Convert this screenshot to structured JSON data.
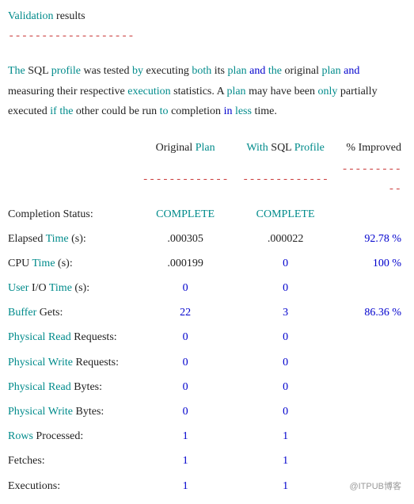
{
  "header": {
    "validation": "Validation",
    "results": "results",
    "divider": "-------------------"
  },
  "intro": {
    "w1": "The",
    "w2": "SQL",
    "w3": "profile",
    "w4": "was tested",
    "w5": "by",
    "w6": "executing",
    "w7": "both",
    "w8": "its",
    "w9": "plan",
    "w10": "and",
    "w11": "the",
    "w12": "original",
    "w13": "plan",
    "w14": "and",
    "w15": "measuring",
    "w16": "their respective",
    "w17": "execution",
    "w18": "statistics. A",
    "w19": "plan",
    "w20": "may have been",
    "w21": "only",
    "w22": "partially executed",
    "w23": "if",
    "w24": "the",
    "w25": "other could be run",
    "w26": "to",
    "w27": "completion",
    "w28": "in",
    "w29": "less",
    "w30": "time."
  },
  "cols": {
    "orig1": "Original",
    "orig2": "Plan",
    "prof1": "With",
    "prof2": "SQL",
    "prof3": "Profile",
    "imp": "% Improved",
    "dash_mid": "-------------",
    "dash_sm": "-----------"
  },
  "rows": {
    "completion": {
      "l1": "Completion",
      "l2": "Status:",
      "orig": "COMPLETE",
      "prof": "COMPLETE",
      "imp": ""
    },
    "elapsed": {
      "l1": "Elapsed",
      "l2": "Time",
      "l3": "(s):",
      "orig": ".000305",
      "prof": ".000022",
      "imp": "92.78 %"
    },
    "cpu": {
      "l1": "CPU",
      "l2": "Time",
      "l3": "(s):",
      "orig": ".000199",
      "prof": "0",
      "imp": "100 %"
    },
    "userio": {
      "l1": "User",
      "l2": "I/O",
      "l3": "Time",
      "l4": "(s):",
      "orig": "0",
      "prof": "0",
      "imp": ""
    },
    "buffer": {
      "l1": "Buffer",
      "l2": "Gets:",
      "orig": "22",
      "prof": "3",
      "imp": "86.36 %"
    },
    "preadreq": {
      "l1": "Physical",
      "l2": "Read",
      "l3": "Requests:",
      "orig": "0",
      "prof": "0",
      "imp": ""
    },
    "pwritereq": {
      "l1": "Physical",
      "l2": "Write",
      "l3": "Requests:",
      "orig": "0",
      "prof": "0",
      "imp": ""
    },
    "preadbyte": {
      "l1": "Physical",
      "l2": "Read",
      "l3": "Bytes:",
      "orig": "0",
      "prof": "0",
      "imp": ""
    },
    "pwritebyte": {
      "l1": "Physical",
      "l2": "Write",
      "l3": "Bytes:",
      "orig": "0",
      "prof": "0",
      "imp": ""
    },
    "rowsproc": {
      "l1": "Rows",
      "l2": "Processed:",
      "orig": "1",
      "prof": "1",
      "imp": ""
    },
    "fetches": {
      "l1": "Fetches:",
      "orig": "1",
      "prof": "1",
      "imp": ""
    },
    "exec": {
      "l1": "Executions:",
      "orig": "1",
      "prof": "1",
      "imp": ""
    }
  },
  "watermark": "@ITPUB博客"
}
